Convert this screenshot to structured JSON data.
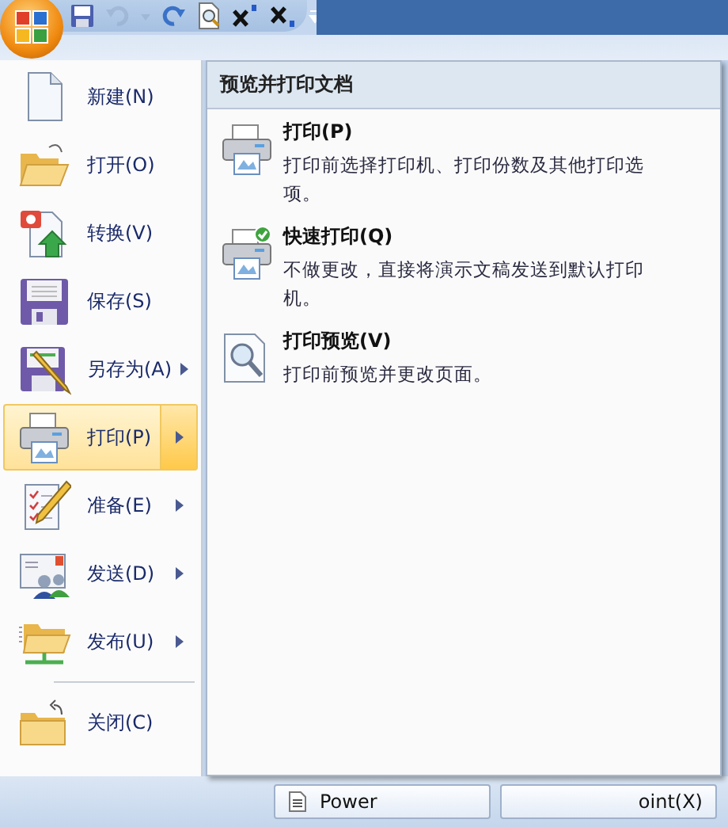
{
  "title_bar": {
    "toolbar": [
      {
        "kind": "save",
        "disabled": false
      },
      {
        "kind": "undo",
        "disabled": true
      },
      {
        "kind": "dropdown",
        "disabled": true
      },
      {
        "kind": "redo",
        "disabled": false
      },
      {
        "kind": "preview",
        "disabled": false
      },
      {
        "kind": "superscript",
        "disabled": false
      },
      {
        "kind": "subscript",
        "disabled": false
      },
      {
        "kind": "customize",
        "disabled": false
      }
    ]
  },
  "menu": {
    "items": [
      {
        "label": "新建(N)",
        "submenu": false,
        "selected": false
      },
      {
        "label": "打开(O)",
        "submenu": false,
        "selected": false
      },
      {
        "label": "转换(V)",
        "submenu": false,
        "selected": false
      },
      {
        "label": "保存(S)",
        "submenu": false,
        "selected": false
      },
      {
        "label": "另存为(A)",
        "submenu": true,
        "selected": false
      },
      {
        "label": "打印(P)",
        "submenu": true,
        "selected": true
      },
      {
        "label": "准备(E)",
        "submenu": true,
        "selected": false
      },
      {
        "label": "发送(D)",
        "submenu": true,
        "selected": false
      },
      {
        "label": "发布(U)",
        "submenu": true,
        "selected": false
      },
      {
        "label": "关闭(C)",
        "submenu": false,
        "selected": false,
        "separator_before": true
      }
    ]
  },
  "submenu": {
    "title": "预览并打印文档",
    "items": [
      {
        "title": "打印(P)",
        "description": "打印前选择打印机、打印份数及其他打印选项。"
      },
      {
        "title": "快速打印(Q)",
        "description": "不做更改，直接将演示文稿发送到默认打印机。"
      },
      {
        "title": "打印预览(V)",
        "description": "打印前预览并更改页面。"
      }
    ]
  },
  "bottom_buttons": [
    {
      "label": "Power"
    },
    {
      "label": "oint(X)"
    }
  ]
}
